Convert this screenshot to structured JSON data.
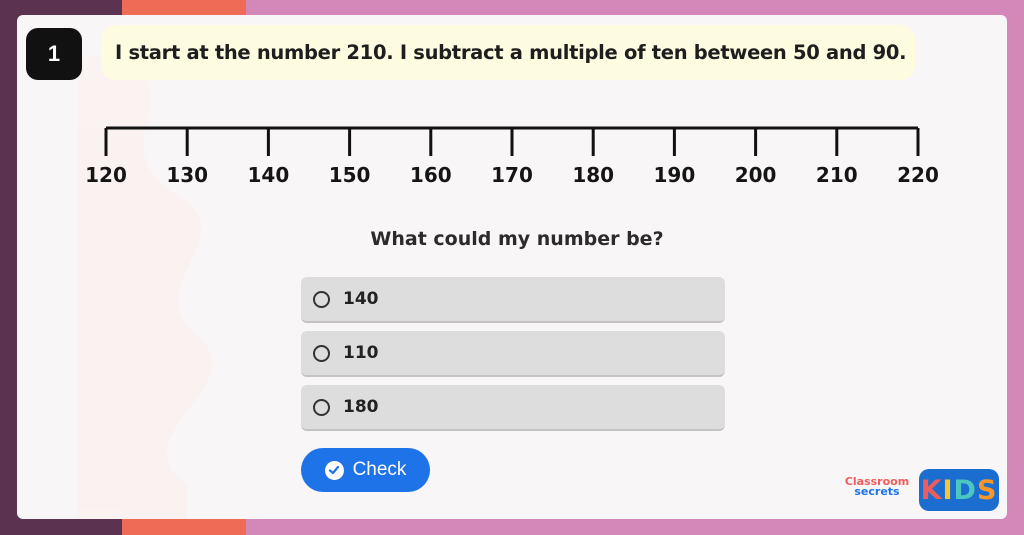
{
  "question": {
    "number": "1",
    "text": "I start at the number 210. I subtract a multiple of ten between 50 and 90."
  },
  "number_line": {
    "ticks": [
      "120",
      "130",
      "140",
      "150",
      "160",
      "170",
      "180",
      "190",
      "200",
      "210",
      "220"
    ]
  },
  "prompt": "What could my number be?",
  "options": [
    {
      "label": "140"
    },
    {
      "label": "110"
    },
    {
      "label": "180"
    }
  ],
  "check_button": {
    "label": "Check",
    "color": "#1e73e8"
  },
  "branding": {
    "word1": "Classroom",
    "word2": "secrets",
    "kids_letters": [
      "K",
      "I",
      "D",
      "S"
    ],
    "kids_colors": [
      "#ef5d5b",
      "#f7c531",
      "#4cc6c1",
      "#f7962a"
    ]
  },
  "colors": {
    "bg_dark": "#5b3350",
    "bg_orange": "#ee6b55",
    "bg_pink": "#d487b9",
    "question_box": "#fdfbe0"
  }
}
